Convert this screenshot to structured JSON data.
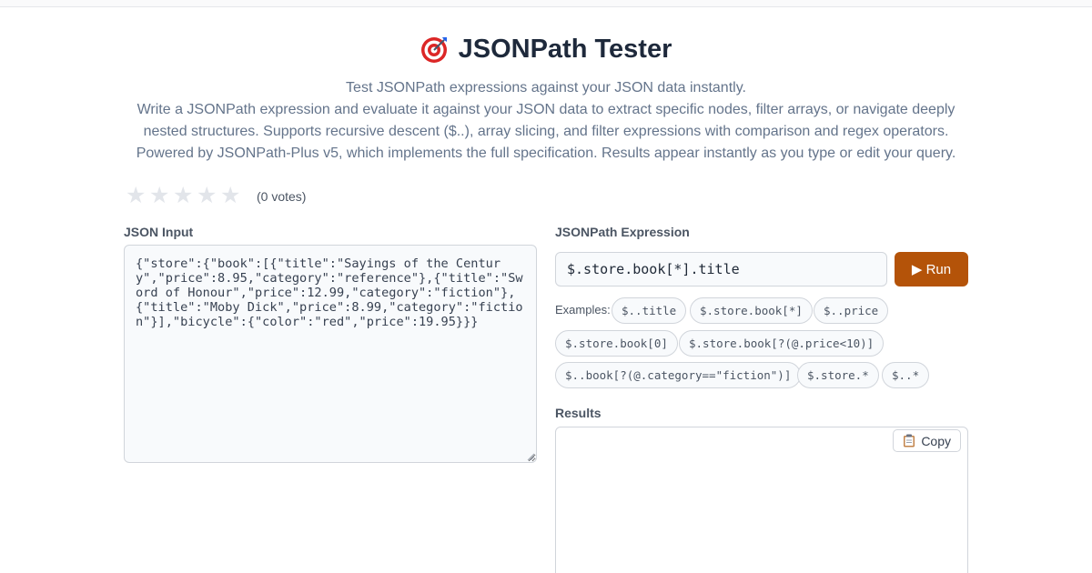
{
  "header": {
    "title": "JSONPath Tester",
    "title_icon": "target-icon",
    "lead": "Test JSONPath expressions against your JSON data instantly.",
    "description": "Write a JSONPath expression and evaluate it against your JSON data to extract specific nodes, filter arrays, or navigate deeply nested structures. Supports recursive descent ($..), array slicing, and filter expressions with comparison and regex operators. Powered by JSONPath-Plus v5, which implements the full specification. Results appear instantly as you type or edit your query."
  },
  "rating": {
    "stars": 5,
    "filled": 0,
    "votes_text": "(0 votes)"
  },
  "json_panel": {
    "label": "JSON Input",
    "value": "{\"store\":{\"book\":[{\"title\":\"Sayings of the Century\",\"price\":8.95,\"category\":\"reference\"},{\"title\":\"Sword of Honour\",\"price\":12.99,\"category\":\"fiction\"},{\"title\":\"Moby Dick\",\"price\":8.99,\"category\":\"fiction\"}],\"bicycle\":{\"color\":\"red\",\"price\":19.95}}}"
  },
  "expression_panel": {
    "label": "JSONPath Expression",
    "value": "$.store.book[*].title",
    "run_label": "▶ Run",
    "examples_label": "Examples:",
    "examples": [
      "$..title",
      "$.store.book[*]",
      "$..price",
      "$.store.book[0]",
      "$.store.book[?(@.price<10)]",
      "$..book[?(@.category==\"fiction\")]",
      "$.store.*",
      "$..*"
    ]
  },
  "results_panel": {
    "label": "Results",
    "copy_label": "Copy",
    "copy_icon": "clipboard-icon",
    "value": ""
  },
  "colors": {
    "accent": "#b45309",
    "title": "#1e293b",
    "muted": "#64748b",
    "border": "#d1d5db"
  }
}
